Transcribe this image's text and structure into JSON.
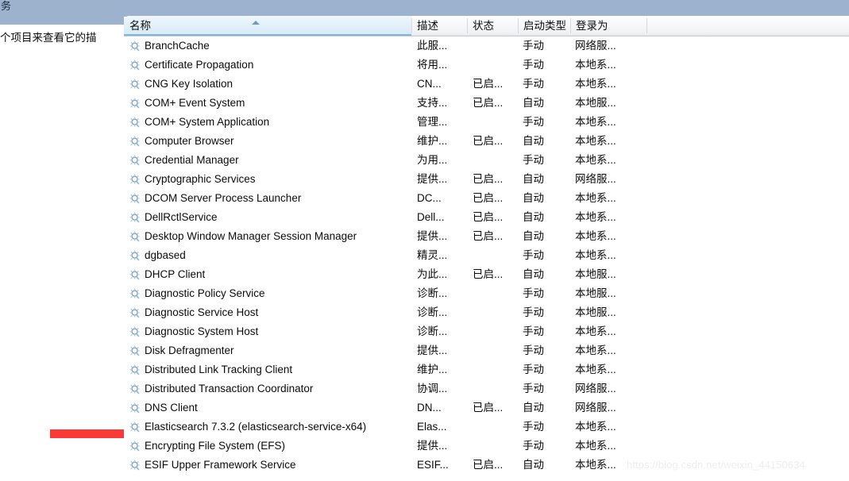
{
  "window": {
    "title_fragment": "务",
    "left_pane_text": "个项目来查看它的描"
  },
  "columns": [
    {
      "key": "name",
      "label": "名称",
      "sorted": true,
      "sort_direction": "asc"
    },
    {
      "key": "desc",
      "label": "描述",
      "sorted": false,
      "sort_direction": ""
    },
    {
      "key": "status",
      "label": "状态",
      "sorted": false,
      "sort_direction": ""
    },
    {
      "key": "start",
      "label": "启动类型",
      "sorted": false,
      "sort_direction": ""
    },
    {
      "key": "logon",
      "label": "登录为",
      "sorted": false,
      "sort_direction": ""
    }
  ],
  "icon": {
    "row_icon": "gear-icon"
  },
  "colors": {
    "chrome": "#9cb2cd",
    "annotation_red": "#f93a36",
    "sorted_header": "#d7eaf6",
    "sort_arrow": "#6b9dc4",
    "watermark": "#eceef0"
  },
  "rows": [
    {
      "name": "BranchCache",
      "desc": "此服...",
      "status": "",
      "start": "手动",
      "logon": "网络服..."
    },
    {
      "name": "Certificate Propagation",
      "desc": "将用...",
      "status": "",
      "start": "手动",
      "logon": "本地系..."
    },
    {
      "name": "CNG Key Isolation",
      "desc": "CN...",
      "status": "已启...",
      "start": "手动",
      "logon": "本地系..."
    },
    {
      "name": "COM+ Event System",
      "desc": "支持...",
      "status": "已启...",
      "start": "自动",
      "logon": "本地服..."
    },
    {
      "name": "COM+ System Application",
      "desc": "管理...",
      "status": "",
      "start": "手动",
      "logon": "本地系..."
    },
    {
      "name": "Computer Browser",
      "desc": "维护...",
      "status": "已启...",
      "start": "自动",
      "logon": "本地系..."
    },
    {
      "name": "Credential Manager",
      "desc": "为用...",
      "status": "",
      "start": "手动",
      "logon": "本地系..."
    },
    {
      "name": "Cryptographic Services",
      "desc": "提供...",
      "status": "已启...",
      "start": "自动",
      "logon": "网络服..."
    },
    {
      "name": "DCOM Server Process Launcher",
      "desc": "DC...",
      "status": "已启...",
      "start": "自动",
      "logon": "本地系..."
    },
    {
      "name": "DellRctlService",
      "desc": "Dell...",
      "status": "已启...",
      "start": "自动",
      "logon": "本地系..."
    },
    {
      "name": "Desktop Window Manager Session Manager",
      "desc": "提供...",
      "status": "已启...",
      "start": "自动",
      "logon": "本地系..."
    },
    {
      "name": "dgbased",
      "desc": "精灵...",
      "status": "",
      "start": "手动",
      "logon": "本地系..."
    },
    {
      "name": "DHCP Client",
      "desc": "为此...",
      "status": "已启...",
      "start": "自动",
      "logon": "本地服..."
    },
    {
      "name": "Diagnostic Policy Service",
      "desc": "诊断...",
      "status": "",
      "start": "手动",
      "logon": "本地服..."
    },
    {
      "name": "Diagnostic Service Host",
      "desc": "诊断...",
      "status": "",
      "start": "手动",
      "logon": "本地服..."
    },
    {
      "name": "Diagnostic System Host",
      "desc": "诊断...",
      "status": "",
      "start": "手动",
      "logon": "本地系..."
    },
    {
      "name": "Disk Defragmenter",
      "desc": "提供...",
      "status": "",
      "start": "手动",
      "logon": "本地系..."
    },
    {
      "name": "Distributed Link Tracking Client",
      "desc": "维护...",
      "status": "",
      "start": "手动",
      "logon": "本地系..."
    },
    {
      "name": "Distributed Transaction Coordinator",
      "desc": "协调...",
      "status": "",
      "start": "手动",
      "logon": "网络服..."
    },
    {
      "name": "DNS Client",
      "desc": "DN...",
      "status": "已启...",
      "start": "自动",
      "logon": "网络服..."
    },
    {
      "name": "Elasticsearch 7.3.2 (elasticsearch-service-x64)",
      "desc": "Elas...",
      "status": "",
      "start": "手动",
      "logon": "本地系..."
    },
    {
      "name": "Encrypting File System (EFS)",
      "desc": "提供...",
      "status": "",
      "start": "手动",
      "logon": "本地系..."
    },
    {
      "name": "ESIF Upper Framework Service",
      "desc": "ESIF...",
      "status": "已启...",
      "start": "自动",
      "logon": "本地系..."
    }
  ],
  "watermark": {
    "text": "https://blog.csdn.net/weixin_44150634"
  }
}
